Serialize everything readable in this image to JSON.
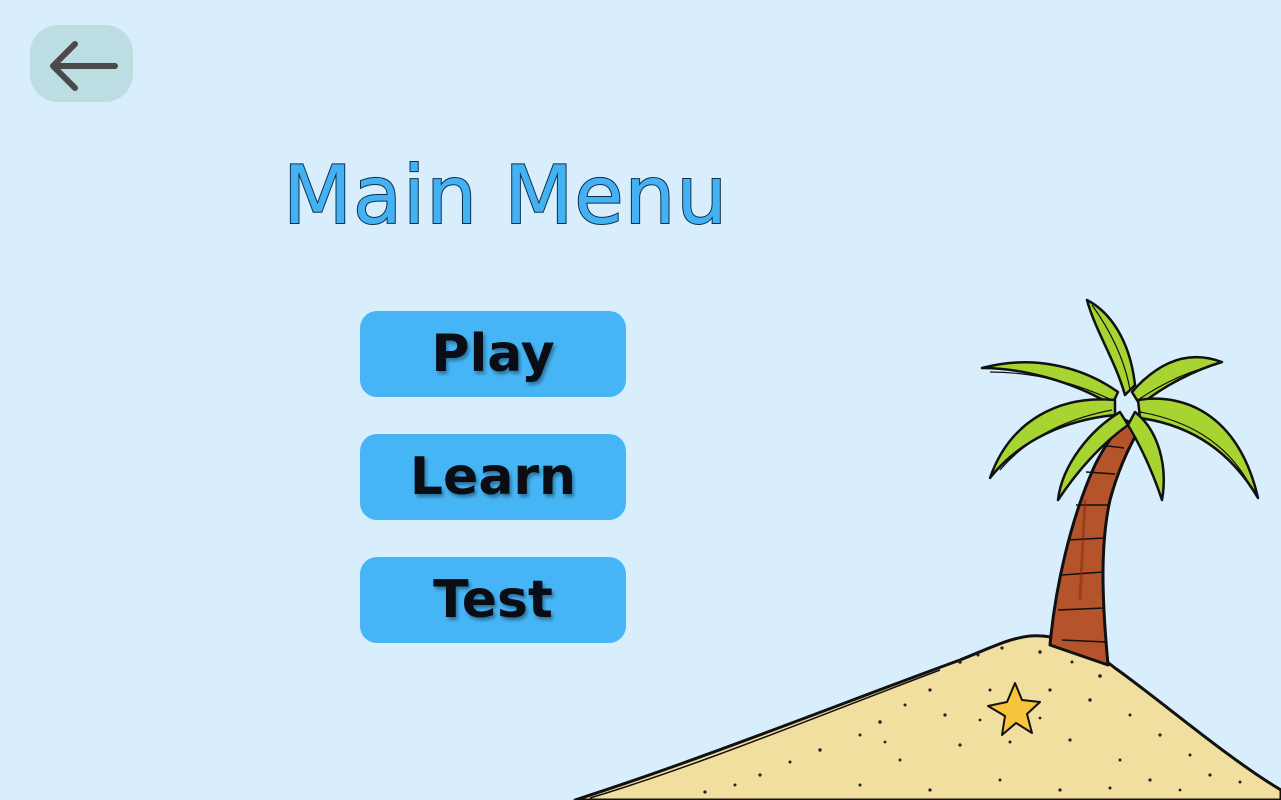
{
  "header": {
    "back_icon": "arrow-left-icon"
  },
  "title": "Main Menu",
  "menu": {
    "items": [
      {
        "label": "Play"
      },
      {
        "label": "Learn"
      },
      {
        "label": "Test"
      }
    ]
  },
  "colors": {
    "background": "#d8eefd",
    "back_button": "#bcdde2",
    "title_fill": "#44b2f2",
    "button_fill": "#46b5f6",
    "sand": "#f1dfa0",
    "palm_leaves": "#a8d431",
    "trunk": "#b5532b",
    "starfish": "#f7c43c"
  },
  "scene": {
    "illustration": "palm-tree-island",
    "decorations": [
      "palm-tree",
      "starfish"
    ]
  }
}
